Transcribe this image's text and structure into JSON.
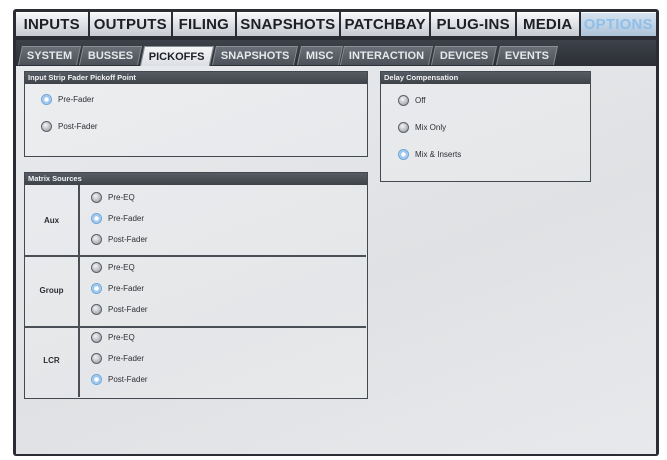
{
  "top_tabs": [
    {
      "label": "INPUTS",
      "active": false
    },
    {
      "label": "OUTPUTS",
      "active": false
    },
    {
      "label": "FILING",
      "active": false
    },
    {
      "label": "SNAPSHOTS",
      "active": false
    },
    {
      "label": "PATCHBAY",
      "active": false
    },
    {
      "label": "PLUG-INS",
      "active": false
    },
    {
      "label": "MEDIA",
      "active": false
    },
    {
      "label": "OPTIONS",
      "active": true
    }
  ],
  "sub_tabs": [
    {
      "label": "SYSTEM",
      "active": false
    },
    {
      "label": "BUSSES",
      "active": false
    },
    {
      "label": "PICKOFFS",
      "active": true
    },
    {
      "label": "SNAPSHOTS",
      "active": false
    },
    {
      "label": "MISC",
      "active": false
    },
    {
      "label": "INTERACTION",
      "active": false
    },
    {
      "label": "DEVICES",
      "active": false
    },
    {
      "label": "EVENTS",
      "active": false
    }
  ],
  "input_strip": {
    "title": "Input Strip Fader Pickoff Point",
    "options": [
      {
        "label": "Pre-Fader",
        "selected": true
      },
      {
        "label": "Post-Fader",
        "selected": false
      }
    ]
  },
  "delay_comp": {
    "title": "Delay Compensation",
    "options": [
      {
        "label": "Off",
        "selected": false
      },
      {
        "label": "Mix Only",
        "selected": false
      },
      {
        "label": "Mix & Inserts",
        "selected": true
      }
    ]
  },
  "matrix": {
    "title": "Matrix Sources",
    "groups": [
      {
        "name": "Aux",
        "options": [
          {
            "label": "Pre-EQ",
            "selected": false
          },
          {
            "label": "Pre-Fader",
            "selected": true
          },
          {
            "label": "Post-Fader",
            "selected": false
          }
        ]
      },
      {
        "name": "Group",
        "options": [
          {
            "label": "Pre-EQ",
            "selected": false
          },
          {
            "label": "Pre-Fader",
            "selected": true
          },
          {
            "label": "Post-Fader",
            "selected": false
          }
        ]
      },
      {
        "name": "LCR",
        "options": [
          {
            "label": "Pre-EQ",
            "selected": false
          },
          {
            "label": "Pre-Fader",
            "selected": false
          },
          {
            "label": "Post-Fader",
            "selected": true
          }
        ]
      }
    ]
  }
}
